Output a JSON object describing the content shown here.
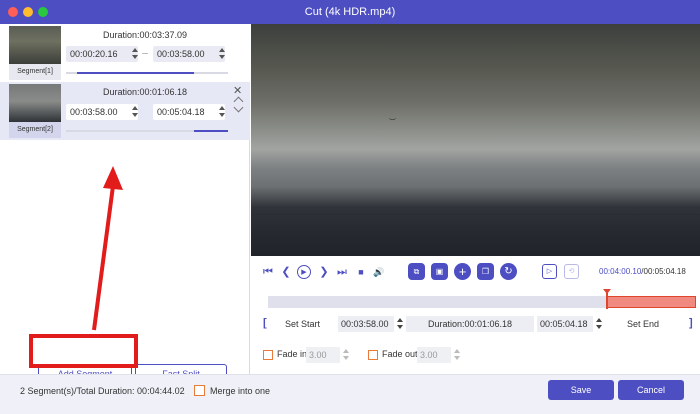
{
  "window": {
    "title": "Cut (4k HDR.mp4)"
  },
  "segments": [
    {
      "label": "Segment[1]",
      "duration": "Duration:00:03:37.09",
      "start": "00:00:20.16",
      "end": "00:03:58.00",
      "progress_start": 0.07,
      "progress_end": 0.79
    },
    {
      "label": "Segment[2]",
      "duration": "Duration:00:01:06.18",
      "start": "00:03:58.00",
      "end": "00:05:04.18",
      "progress_start": 0.79,
      "progress_end": 1.0
    }
  ],
  "segment_controls": {
    "close_glyph": "✕"
  },
  "buttons": {
    "add_segment": "Add Segment",
    "fast_split": "Fast Split",
    "save": "Save",
    "cancel": "Cancel"
  },
  "player": {
    "current_time": "00:04:00.10",
    "total_time": "00:05:04.18",
    "separator": "/",
    "icons": {
      "to_start": "⏮",
      "prev": "❮",
      "play": "▶",
      "next": "❯",
      "to_end": "⏭",
      "stop": "■",
      "volume": "🔊",
      "split": "⧉",
      "snapshot": "▣",
      "add": "+",
      "copy": "❐",
      "rotate": "↻",
      "play_segment": "▷",
      "loop": "⟲"
    }
  },
  "timeline": {
    "selection_start": 0.79,
    "selection_end": 1.0,
    "playhead": 0.79
  },
  "trim": {
    "set_start": "Set Start",
    "set_end": "Set End",
    "start_value": "00:03:58.00",
    "end_value": "00:05:04.18",
    "duration": "Duration:00:01:06.18",
    "left_bracket": "[",
    "right_bracket": "]"
  },
  "fade": {
    "fade_in_label": "Fade in",
    "fade_in_value": "3.00",
    "fade_out_label": "Fade out",
    "fade_out_value": "3.00"
  },
  "bottom": {
    "summary": "2 Segment(s)/Total Duration: 00:04:44.02",
    "merge_label": "Merge into one"
  },
  "colors": {
    "accent": "#4c4ec2",
    "highlight": "#e21b1b",
    "checkbox": "#e87a3a",
    "timeline_selection": "#f08a80"
  }
}
